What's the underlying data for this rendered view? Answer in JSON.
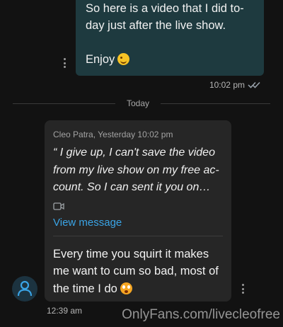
{
  "outgoing": {
    "lines": [
      "So here is a video that I did to-",
      "day just after the live show."
    ],
    "closing": "Enjoy",
    "emoji": "winking-face",
    "time": "10:02 pm",
    "status_icon": "double-check-icon"
  },
  "divider": {
    "label": "Today"
  },
  "incoming": {
    "quote_author": "Cleo Patra, Yesterday 10:02 pm",
    "quote_lines": [
      "“ I give up, I can't save the video",
      "from my live show on my free ac-",
      "count. So I can sent it you on…"
    ],
    "attachment_icon": "video-camera-icon",
    "view_message_label": "View message",
    "reply_lines": [
      "Every time you squirt it makes",
      "me want to cum so bad, most of",
      "the time I do"
    ],
    "reply_emoji": "flushed-face",
    "time": "12:39 am"
  },
  "watermark": "OnlyFans.com/livecleofree",
  "colors": {
    "background": "#121212",
    "outgoing_bubble": "#1e3a3f",
    "incoming_bubble": "#262626",
    "link": "#3aa4e6",
    "avatar_icon": "#3aa4e6"
  }
}
